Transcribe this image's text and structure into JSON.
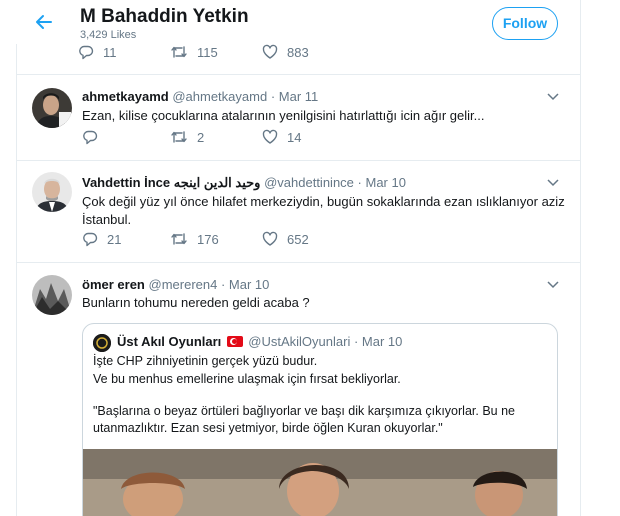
{
  "header": {
    "name": "M Bahaddin Yetkin",
    "likes": "3,429 Likes",
    "follow_label": "Follow"
  },
  "prev_tweet_actions": {
    "replies": "11",
    "retweets": "115",
    "likes": "883"
  },
  "tweets": [
    {
      "name": "ahmetkayamd",
      "handle": "@ahmetkayamd",
      "date": "Mar 11",
      "text": "Ezan, kilise çocuklarına atalarının yenilgisini hatırlattığı icin ağır gelir...",
      "replies": "",
      "retweets": "2",
      "likes": "14"
    },
    {
      "name": "Vahdettin İnce وحيد الدين اينجه",
      "handle": "@vahdettinince",
      "date": "Mar 10",
      "text_lines": [
        "Çok değil yüz yıl önce hilafet merkeziydin, bugün sokaklarında ezan ıslıklanıyor aziz",
        "İstanbul."
      ],
      "replies": "21",
      "retweets": "176",
      "likes": "652"
    },
    {
      "name": "ömer eren",
      "handle": "@mereren4",
      "date": "Mar 10",
      "text": "Bunların tohumu nereden geldi acaba ?"
    }
  ],
  "quote": {
    "name": "Üst Akıl Oyunları",
    "handle": "@UstAkilOyunlari",
    "date": "Mar 10",
    "lines": [
      "İşte CHP zihniyetinin gerçek yüzü budur.",
      "Ve bu menhus emellerine ulaşmak için fırsat bekliyorlar.",
      "",
      "\"Başlarına o beyaz örtüleri bağlıyorlar ve başı dik karşımıza çıkıyorlar. Bu ne",
      "utanmazlıktır. Ezan sesi yetmiyor, birde öğlen Kuran okuyorlar.\""
    ]
  },
  "colors": {
    "accent": "#1da1f2",
    "muted": "#657786",
    "border": "#e6ecf0"
  },
  "icons": [
    "back-arrow-icon",
    "reply-icon",
    "retweet-icon",
    "like-icon",
    "chevron-down-icon",
    "turkey-flag-icon"
  ]
}
